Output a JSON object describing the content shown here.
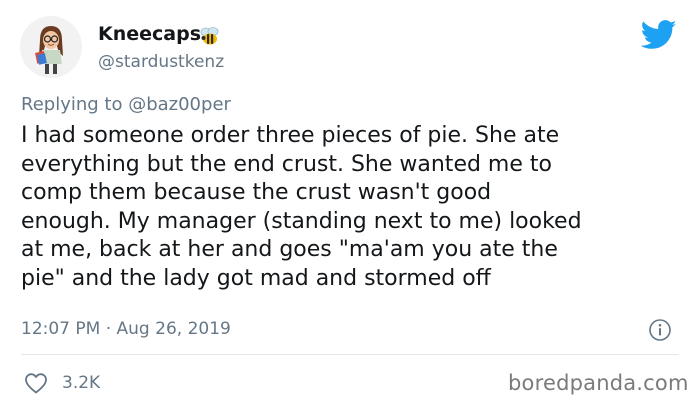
{
  "author": {
    "display_name": "Kneecaps",
    "emoji": "bee-emoji",
    "handle": "@stardustkenz",
    "avatar_icon": "bitmoji-avatar-icon"
  },
  "platform": {
    "logo_icon": "twitter-bird-icon",
    "brand_color": "#1da1f2"
  },
  "reply": {
    "prefix": "Replying to ",
    "mention": "@baz00per"
  },
  "tweet": {
    "text": "I had someone order three pieces of pie. She ate\neverything but the end crust. She wanted me to\ncomp them because the crust wasn't good\nenough. My manager (standing next to me) looked\nat me, back at her and goes \"ma'am you ate the\npie\" and the lady got mad and stormed off",
    "timestamp": "12:07 PM · Aug 26, 2019",
    "info_icon": "info-icon"
  },
  "engagement": {
    "like_icon": "heart-icon",
    "like_count": "3.2K"
  },
  "watermark": {
    "text": "boredpanda.com"
  },
  "colors": {
    "text_primary": "#14171a",
    "text_secondary": "#657786",
    "divider": "#e1e8ed",
    "watermark": "#7a7a7a"
  }
}
